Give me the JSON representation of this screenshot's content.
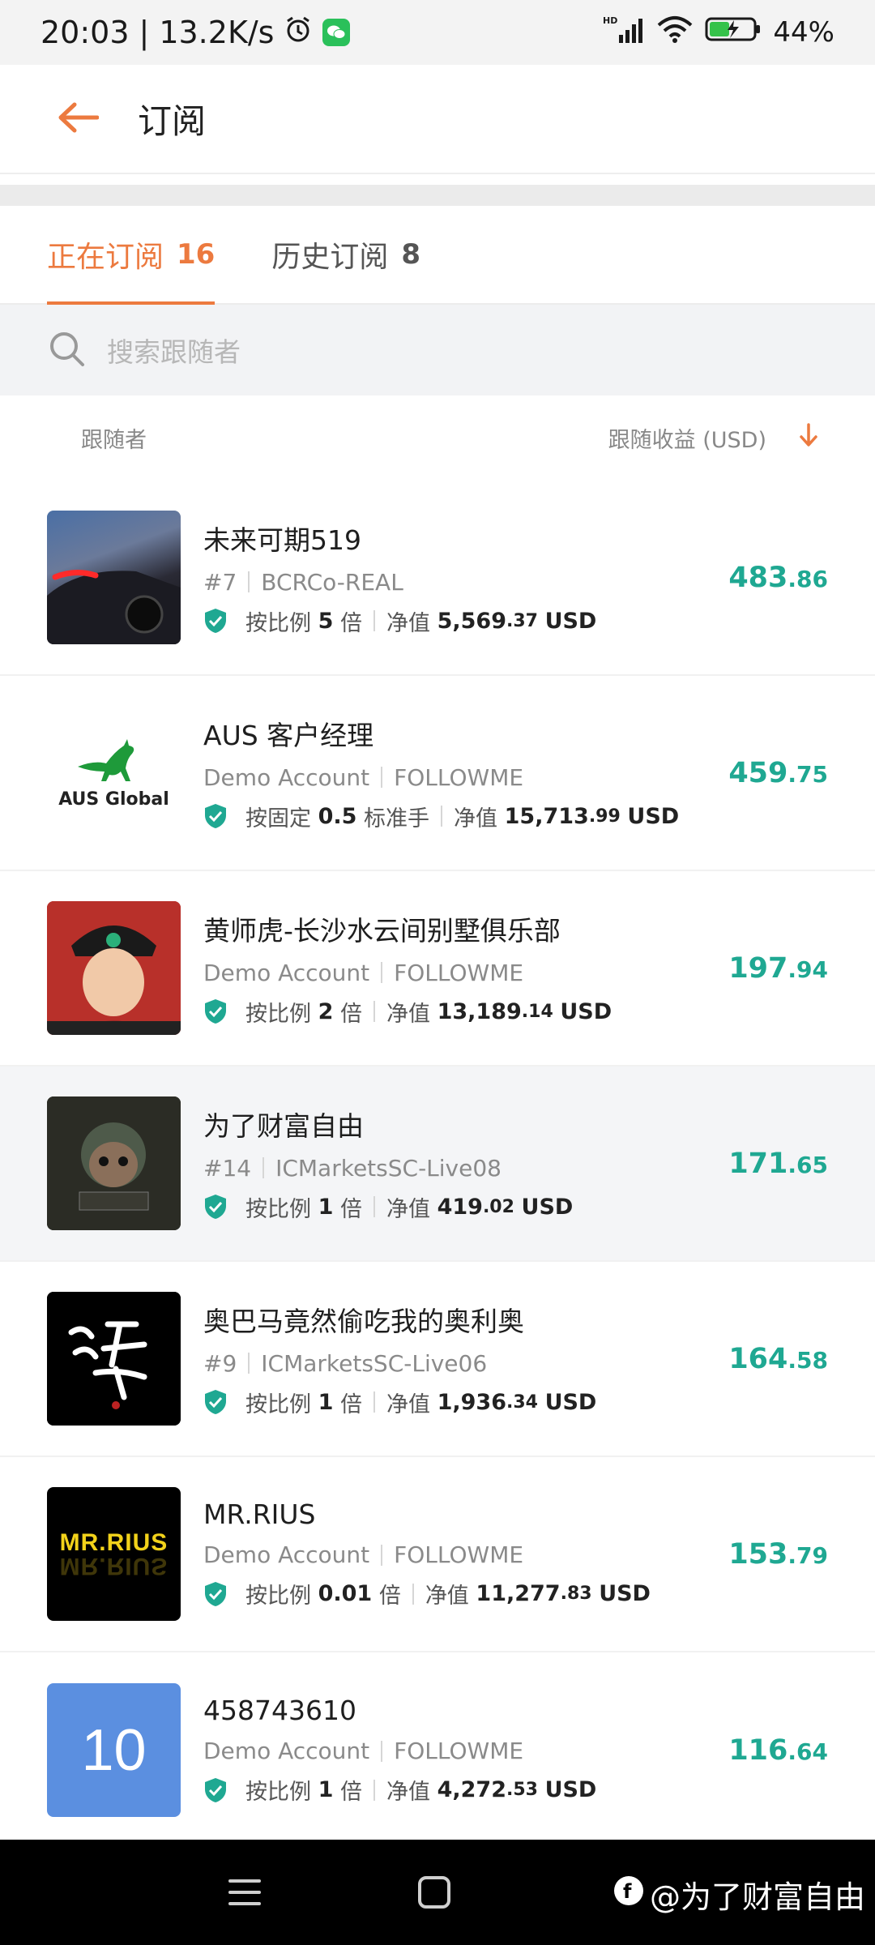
{
  "status_bar": {
    "time": "20:03",
    "speed": "13.2K/s",
    "battery": "44%",
    "network": "HD"
  },
  "app_bar": {
    "title": "订阅"
  },
  "tabs": [
    {
      "label": "正在订阅",
      "count": "16",
      "active": true
    },
    {
      "label": "历史订阅",
      "count": "8",
      "active": false
    }
  ],
  "search": {
    "placeholder": "搜索跟随者"
  },
  "list_header": {
    "left": "跟随者",
    "right": "跟随收益 (USD)"
  },
  "followers": [
    {
      "name": "未来可期519",
      "sub_a": "#7",
      "sub_b": "BCRCo-REAL",
      "mode": "按比例",
      "mode_value": "5",
      "mode_unit": "倍",
      "equity_label": "净值",
      "equity_int": "5,569",
      "equity_dec": ".37",
      "currency": "USD",
      "profit_int": "483",
      "profit_dec": ".86"
    },
    {
      "name": "AUS 客户经理",
      "sub_a": "Demo Account",
      "sub_b": "FOLLOWME",
      "mode": "按固定",
      "mode_value": "0.5",
      "mode_unit": "标准手",
      "equity_label": "净值",
      "equity_int": "15,713",
      "equity_dec": ".99",
      "currency": "USD",
      "profit_int": "459",
      "profit_dec": ".75",
      "avatar_text": "AUS Global"
    },
    {
      "name": "黄师虎-长沙水云间别墅俱乐部",
      "sub_a": "Demo Account",
      "sub_b": "FOLLOWME",
      "mode": "按比例",
      "mode_value": "2",
      "mode_unit": "倍",
      "equity_label": "净值",
      "equity_int": "13,189",
      "equity_dec": ".14",
      "currency": "USD",
      "profit_int": "197",
      "profit_dec": ".94"
    },
    {
      "name": "为了财富自由",
      "sub_a": "#14",
      "sub_b": "ICMarketsSC-Live08",
      "mode": "按比例",
      "mode_value": "1",
      "mode_unit": "倍",
      "equity_label": "净值",
      "equity_int": "419",
      "equity_dec": ".02",
      "currency": "USD",
      "profit_int": "171",
      "profit_dec": ".65"
    },
    {
      "name": "奥巴马竟然偷吃我的奥利奥",
      "sub_a": "#9",
      "sub_b": "ICMarketsSC-Live06",
      "mode": "按比例",
      "mode_value": "1",
      "mode_unit": "倍",
      "equity_label": "净值",
      "equity_int": "1,936",
      "equity_dec": ".34",
      "currency": "USD",
      "profit_int": "164",
      "profit_dec": ".58"
    },
    {
      "name": "MR.RIUS",
      "sub_a": "Demo Account",
      "sub_b": "FOLLOWME",
      "mode": "按比例",
      "mode_value": "0.01",
      "mode_unit": "倍",
      "equity_label": "净值",
      "equity_int": "11,277",
      "equity_dec": ".83",
      "currency": "USD",
      "profit_int": "153",
      "profit_dec": ".79",
      "avatar_text": "MR.RIUS"
    },
    {
      "name": "458743610",
      "sub_a": "Demo Account",
      "sub_b": "FOLLOWME",
      "mode": "按比例",
      "mode_value": "1",
      "mode_unit": "倍",
      "equity_label": "净值",
      "equity_int": "4,272",
      "equity_dec": ".53",
      "currency": "USD",
      "profit_int": "116",
      "profit_dec": ".64",
      "avatar_text": "10"
    }
  ],
  "watermark": {
    "text": "@为了财富自由"
  },
  "colors": {
    "accent": "#ec7a3f",
    "profit": "#1fa892",
    "shield": "#1fa892"
  },
  "icons": [
    "back-arrow-icon",
    "search-icon",
    "sort-down-icon",
    "shield-check-icon",
    "alarm-icon",
    "wechat-icon",
    "signal-icon",
    "wifi-icon",
    "battery-icon",
    "menu-icon",
    "home-icon"
  ]
}
